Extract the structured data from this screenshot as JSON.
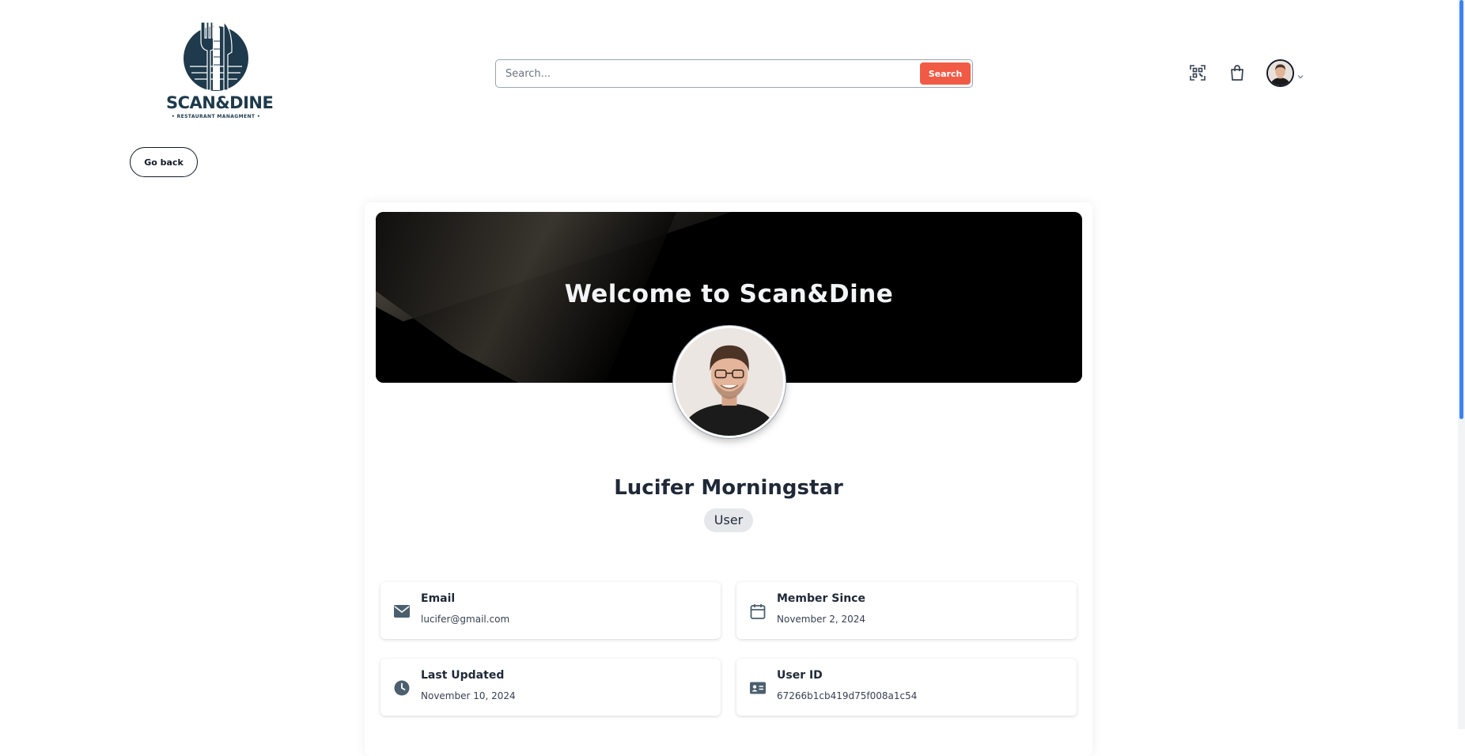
{
  "brand": {
    "name": "SCAN&DINE",
    "tagline": "• RESTAURANT MANAGMENT •"
  },
  "search": {
    "placeholder": "Search...",
    "button_label": "Search"
  },
  "header": {
    "icons": [
      "qr-scan-icon",
      "shopping-bag-icon",
      "chevron-down-icon"
    ]
  },
  "nav": {
    "go_back_label": "Go back"
  },
  "profile": {
    "banner_title": "Welcome to Scan&Dine",
    "name": "Lucifer Morningstar",
    "role": "User",
    "details": {
      "email_label": "Email",
      "email_value": "lucifer@gmail.com",
      "member_since_label": "Member Since",
      "member_since_value": "November 2, 2024",
      "last_updated_label": "Last Updated",
      "last_updated_value": "November 10, 2024",
      "user_id_label": "User ID",
      "user_id_value": "67266b1cb419d75f008a1c54"
    }
  },
  "colors": {
    "accent": "#f15a45",
    "brand_navy": "#1e3a4c",
    "icon_slate": "#4b5f6e",
    "scrollbar_thumb": "#3b82f6"
  }
}
